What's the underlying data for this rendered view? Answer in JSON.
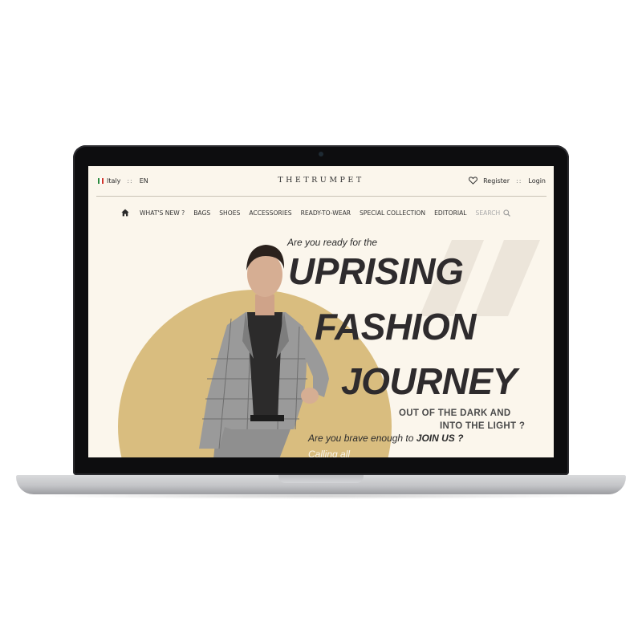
{
  "topbar": {
    "country": "Italy",
    "separator": "::",
    "language": "EN",
    "brand": "THETRUMPET",
    "register_label": "Register",
    "login_label": "Login"
  },
  "nav": {
    "items": [
      "WHAT'S NEW ?",
      "BAGS",
      "SHOES",
      "ACCESSORIES",
      "READY-TO-WEAR",
      "SPECIAL COLLECTION",
      "EDITORIAL"
    ],
    "search_label": "SEARCH"
  },
  "hero": {
    "eyebrow": "Are you ready for the",
    "headline": [
      "UPRISING",
      "FASHION",
      "JOURNEY"
    ],
    "tagline": [
      "OUT OF THE DARK AND",
      "INTO THE LIGHT ?"
    ],
    "cta_prefix": "Are you brave enough to",
    "cta_emphasis": "JOIN US ?",
    "calling": "Calling all"
  },
  "icons": {
    "flag": "italy-flag-icon",
    "heart": "heart-icon",
    "home": "home-icon",
    "search": "search-icon"
  },
  "colors": {
    "screen_background": "#fbf6ec",
    "accent_circle": "#d9bd7f",
    "headline": "#2e2b2d"
  }
}
